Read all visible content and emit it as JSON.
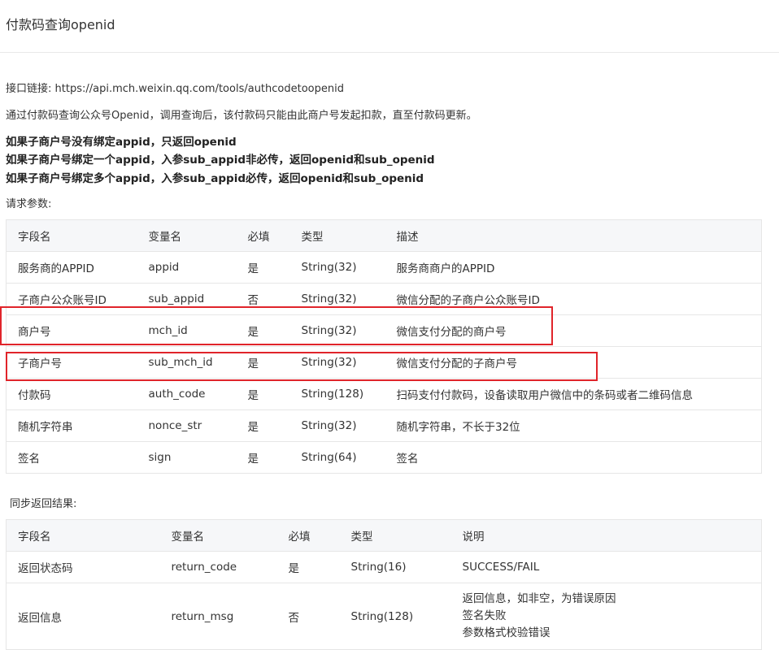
{
  "page": {
    "title": "付款码查询openid"
  },
  "intro": {
    "api_link": "接口链接: https://api.mch.weixin.qq.com/tools/authcodetoopenid",
    "description": "通过付款码查询公众号Openid，调用查询后，该付款码只能由此商户号发起扣款，直至付款码更新。",
    "notes": [
      "如果子商户号没有绑定appid，只返回openid",
      "如果子商户号绑定一个appid，入参sub_appid非必传，返回openid和sub_openid",
      "如果子商户号绑定多个appid，入参sub_appid必传，返回openid和sub_openid"
    ]
  },
  "request": {
    "heading": "请求参数:",
    "headers": [
      "字段名",
      "变量名",
      "必填",
      "类型",
      "描述"
    ],
    "rows": [
      [
        "服务商的APPID",
        "appid",
        "是",
        "String(32)",
        "服务商商户的APPID"
      ],
      [
        "子商户公众账号ID",
        "sub_appid",
        "否",
        "String(32)",
        "微信分配的子商户公众账号ID"
      ],
      [
        "商户号",
        "mch_id",
        "是",
        "String(32)",
        "微信支付分配的商户号"
      ],
      [
        "子商户号",
        "sub_mch_id",
        "是",
        "String(32)",
        "微信支付分配的子商户号"
      ],
      [
        "付款码",
        "auth_code",
        "是",
        "String(128)",
        "扫码支付付款码，设备读取用户微信中的条码或者二维码信息"
      ],
      [
        "随机字符串",
        "nonce_str",
        "是",
        "String(32)",
        "随机字符串，不长于32位"
      ],
      [
        "签名",
        "sign",
        "是",
        "String(64)",
        "签名"
      ]
    ]
  },
  "response": {
    "heading": "同步返回结果:",
    "headers": [
      "字段名",
      "变量名",
      "必填",
      "类型",
      "说明"
    ],
    "row1": [
      "返回状态码",
      "return_code",
      "是",
      "String(16)",
      "SUCCESS/FAIL"
    ],
    "row2": {
      "field": "返回信息",
      "var": "return_msg",
      "required": "否",
      "type": "String(128)",
      "desc_lines": [
        "返回信息，如非空，为错误原因",
        "签名失败",
        "参数格式校验错误"
      ]
    }
  },
  "highlight_color": "#e0242a"
}
